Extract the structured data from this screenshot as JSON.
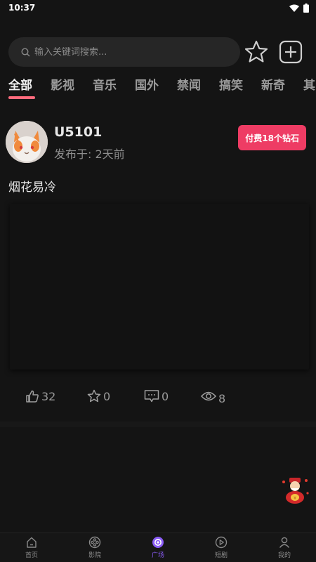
{
  "status": {
    "time": "10:37"
  },
  "search": {
    "placeholder": "输入关键词搜索..."
  },
  "tabs": [
    {
      "label": "全部",
      "active": true
    },
    {
      "label": "影视",
      "active": false
    },
    {
      "label": "音乐",
      "active": false
    },
    {
      "label": "国外",
      "active": false
    },
    {
      "label": "禁闻",
      "active": false
    },
    {
      "label": "搞笑",
      "active": false
    },
    {
      "label": "新奇",
      "active": false
    },
    {
      "label": "其",
      "active": false
    }
  ],
  "post": {
    "username": "U5101",
    "time": "发布于: 2天前",
    "pay_label": "付费18个钻石",
    "title": "烟花易冷",
    "likes": "32",
    "favorites": "0",
    "comments": "0",
    "views": "8"
  },
  "nav": [
    {
      "label": "首页",
      "icon": "home-icon",
      "active": false
    },
    {
      "label": "影院",
      "icon": "film-reel-icon",
      "active": false
    },
    {
      "label": "广场",
      "icon": "plaza-icon",
      "active": true
    },
    {
      "label": "短剧",
      "icon": "play-circle-icon",
      "active": false
    },
    {
      "label": "我的",
      "icon": "user-icon",
      "active": false
    }
  ],
  "colors": {
    "accent_pink": "#ee3c64",
    "tab_underline": "#ff6b7d",
    "nav_active": "#8a5cf6",
    "background": "#141414"
  }
}
